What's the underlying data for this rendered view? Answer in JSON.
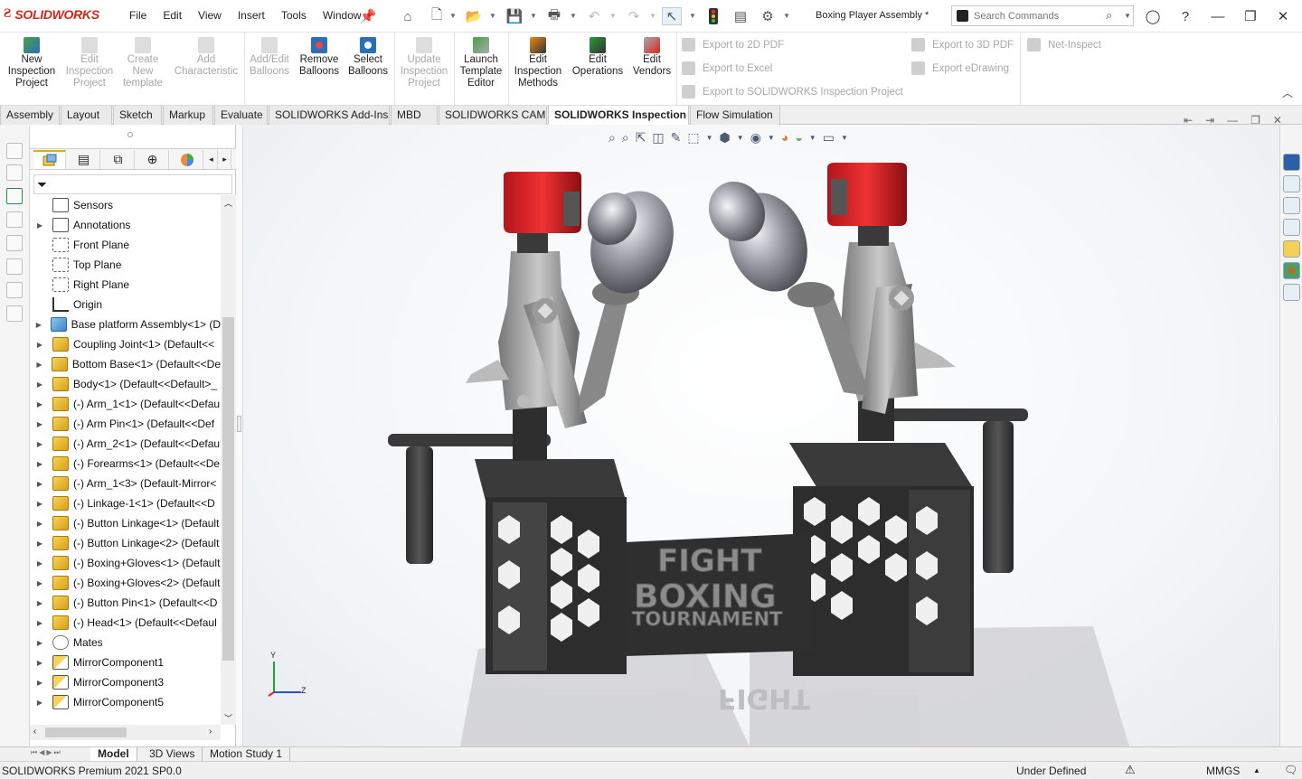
{
  "app": {
    "brand": "SOLIDWORKS",
    "document_title": "Boxing Player Assembly *",
    "search_placeholder": "Search Commands",
    "accent": "#d6261c"
  },
  "menu": [
    "File",
    "Edit",
    "View",
    "Insert",
    "Tools",
    "Window"
  ],
  "ribbon": {
    "buttons": [
      {
        "label": "New Inspection Project",
        "enabled": true
      },
      {
        "label": "Edit Inspection Project",
        "enabled": false
      },
      {
        "label": "Create New template",
        "enabled": false
      },
      {
        "label": "Add Characteristic",
        "enabled": false
      },
      {
        "label": "Add/Edit Balloons",
        "enabled": false
      },
      {
        "label": "Remove Balloons",
        "enabled": true
      },
      {
        "label": "Select Balloons",
        "enabled": true
      },
      {
        "label": "Update Inspection Project",
        "enabled": false
      },
      {
        "label": "Launch Template Editor",
        "enabled": true
      },
      {
        "label": "Edit Inspection Methods",
        "enabled": true
      },
      {
        "label": "Edit Operations",
        "enabled": true
      },
      {
        "label": "Edit Vendors",
        "enabled": true
      }
    ],
    "exports": [
      "Export to 2D PDF",
      "Export to Excel",
      "Export to SOLIDWORKS Inspection Project",
      "Export to 3D PDF",
      "Export eDrawing",
      "Net-Inspect"
    ]
  },
  "command_tabs": [
    "Assembly",
    "Layout",
    "Sketch",
    "Markup",
    "Evaluate",
    "SOLIDWORKS Add-Ins",
    "MBD",
    "SOLIDWORKS CAM",
    "SOLIDWORKS Inspection",
    "Flow Simulation"
  ],
  "active_command_tab": "SOLIDWORKS Inspection",
  "feature_tree": [
    {
      "label": "Sensors",
      "icon": "sensor-icon",
      "expandable": false
    },
    {
      "label": "Annotations",
      "icon": "annotations-icon",
      "expandable": true
    },
    {
      "label": "Front Plane",
      "icon": "plane-icon",
      "expandable": false
    },
    {
      "label": "Top Plane",
      "icon": "plane-icon",
      "expandable": false
    },
    {
      "label": "Right Plane",
      "icon": "plane-icon",
      "expandable": false
    },
    {
      "label": "Origin",
      "icon": "origin-icon",
      "expandable": false
    },
    {
      "label": "Base platform Assembly<1> (D",
      "icon": "assembly-icon",
      "expandable": true
    },
    {
      "label": "Coupling Joint<1> (Default<<",
      "icon": "part-icon",
      "expandable": true
    },
    {
      "label": "Bottom Base<1> (Default<<De",
      "icon": "part-icon",
      "expandable": true
    },
    {
      "label": "Body<1> (Default<<Default>_",
      "icon": "part-icon",
      "expandable": true
    },
    {
      "label": "(-) Arm_1<1> (Default<<Defau",
      "icon": "part-icon",
      "expandable": true
    },
    {
      "label": "(-) Arm Pin<1> (Default<<Def",
      "icon": "part-icon",
      "expandable": true
    },
    {
      "label": "(-) Arm_2<1> (Default<<Defau",
      "icon": "part-icon",
      "expandable": true
    },
    {
      "label": "(-) Forearms<1> (Default<<De",
      "icon": "part-icon",
      "expandable": true
    },
    {
      "label": "(-) Arm_1<3> (Default-Mirror<",
      "icon": "part-icon",
      "expandable": true
    },
    {
      "label": "(-) Linkage-1<1> (Default<<D",
      "icon": "part-icon",
      "expandable": true
    },
    {
      "label": "(-) Button Linkage<1> (Default",
      "icon": "part-icon",
      "expandable": true
    },
    {
      "label": "(-) Button Linkage<2> (Default",
      "icon": "part-icon",
      "expandable": true
    },
    {
      "label": "(-) Boxing+Gloves<1> (Default",
      "icon": "part-icon",
      "expandable": true
    },
    {
      "label": "(-) Boxing+Gloves<2> (Default",
      "icon": "part-icon",
      "expandable": true
    },
    {
      "label": "(-) Button Pin<1> (Default<<D",
      "icon": "part-icon",
      "expandable": true
    },
    {
      "label": "(-) Head<1> (Default<<Defaul",
      "icon": "part-icon",
      "expandable": true
    },
    {
      "label": "Mates",
      "icon": "mates-icon",
      "expandable": true
    },
    {
      "label": "MirrorComponent1",
      "icon": "mirror-component-icon",
      "expandable": true
    },
    {
      "label": "MirrorComponent3",
      "icon": "mirror-component-icon",
      "expandable": true
    },
    {
      "label": "MirrorComponent5",
      "icon": "mirror-component-icon",
      "expandable": true
    }
  ],
  "model_text": {
    "line1": "FIGHT",
    "line2": "BOXING",
    "line3": "TOURNAMENT"
  },
  "triad": {
    "y": "Y",
    "z": "Z"
  },
  "bottom_tabs": [
    "Model",
    "3D Views",
    "Motion Study 1"
  ],
  "active_bottom_tab": "Model",
  "status": {
    "version": "SOLIDWORKS Premium 2021 SP0.0",
    "state": "Under Defined",
    "units": "MMGS"
  }
}
